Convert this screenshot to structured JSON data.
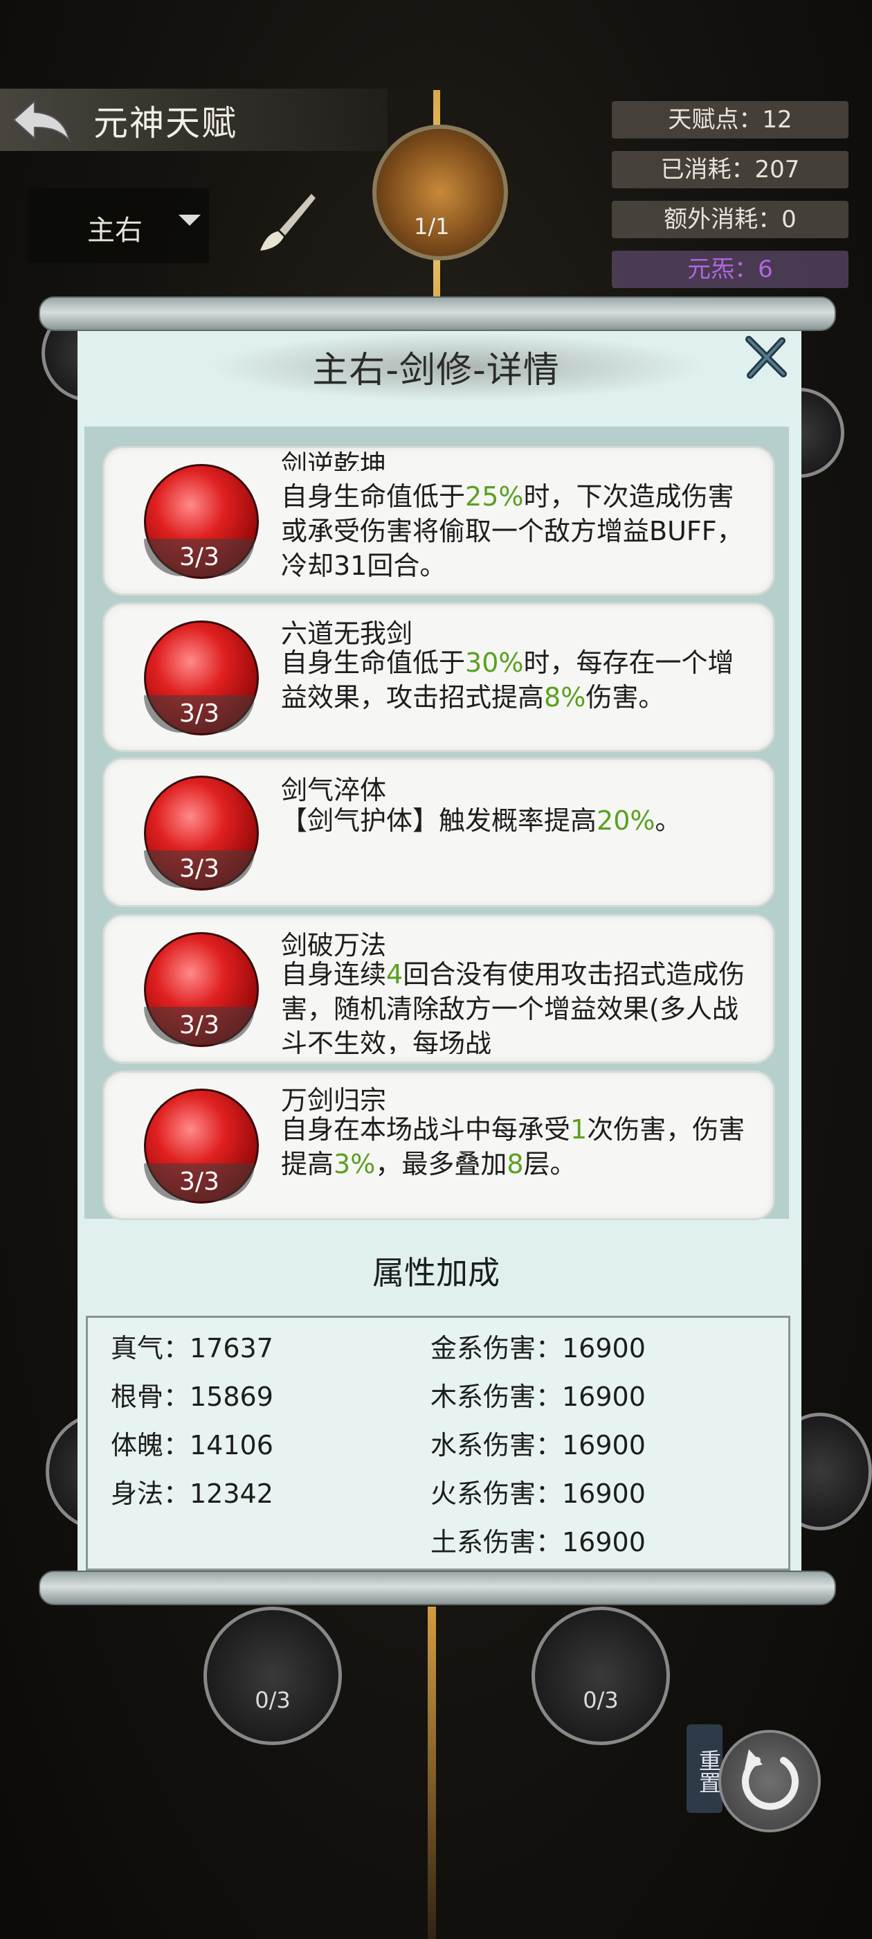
{
  "header": {
    "title": "元神天赋",
    "stats": [
      "天赋点：12",
      "已消耗：207",
      "额外消耗：0",
      "元炁：6"
    ],
    "dropdown_value": "主右",
    "top_node_count": "1/1"
  },
  "panel": {
    "title": "主右-剑修-详情",
    "skills": [
      {
        "name": "剑逆乾坤",
        "count": "3/3",
        "desc_parts": [
          "自身生命值低于",
          "25%",
          "时，下次造成伤害或承受伤害将偷取一个敌方增益BUFF，冷却31回合。"
        ]
      },
      {
        "name": "六道无我剑",
        "count": "3/3",
        "desc_parts": [
          "自身生命值低于",
          "30%",
          "时，每存在一个增益效果，攻击招式提高",
          "8%",
          "伤害。"
        ]
      },
      {
        "name": "剑气淬体",
        "count": "3/3",
        "desc_parts": [
          "【剑气护体】触发概率提高",
          "20%",
          "。"
        ]
      },
      {
        "name": "剑破万法",
        "count": "3/3",
        "desc_parts": [
          "自身连续",
          "4",
          "回合没有使用攻击招式造成伤害，随机清除敌方一个增益效果(多人战斗不生效，每场战"
        ]
      },
      {
        "name": "万剑归宗",
        "count": "3/3",
        "desc_parts": [
          "自身在本场战斗中每承受",
          "1",
          "次伤害，伤害提高",
          "3%",
          "，最多叠加",
          "8",
          "层。"
        ]
      }
    ],
    "section_title": "属性加成",
    "attributes_left": [
      "真气：17637",
      "根骨：15869",
      "体魄：14106",
      "身法：12342"
    ],
    "attributes_right": [
      "金系伤害：16900",
      "木系伤害：16900",
      "水系伤害：16900",
      "火系伤害：16900",
      "土系伤害：16900"
    ]
  },
  "bottom": {
    "node_left_count": "0/3",
    "node_right_count": "0/3",
    "reset_label": "重置"
  },
  "colors": {
    "highlight_green": "#5aa020",
    "purple_stat": "#b066e0",
    "panel_bg": "#dff0ee"
  }
}
